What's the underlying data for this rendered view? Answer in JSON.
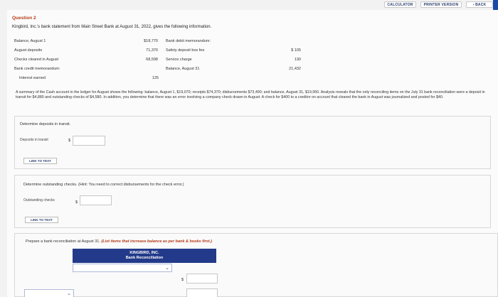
{
  "toolbar": {
    "calculator": "CALCULATOR",
    "printer_version": "PRINTER VERSION",
    "back": "‹ BACK"
  },
  "question": {
    "title": "Question 2",
    "intro": "Kingbird, Inc.'s bank statement from Main Street Bank at August 31, 2022, gives the following information.",
    "facts_left": [
      {
        "label": "Balance, August 1",
        "value": "$18,770"
      },
      {
        "label": "August deposits",
        "value": "71,370"
      },
      {
        "label": "Checks cleared in August",
        "value": "68,598"
      },
      {
        "label": "Bank credit memorandum:",
        "value": ""
      },
      {
        "label": "Interest earned",
        "value": "125"
      }
    ],
    "facts_right": [
      {
        "label": "Bank debit memorandum:",
        "value": ""
      },
      {
        "label": "Safety deposit box fee",
        "value": "$ 105"
      },
      {
        "label": "Service charge",
        "value": "130"
      },
      {
        "label": "Balance, August 31",
        "value": "21,432"
      }
    ],
    "paragraph": "A summary of the Cash account in the ledger for August shows the following: balance, August 1, $19,070; receipts $74,370; disbursements $73,490; and balance, August 31, $19,950. Analysis reveals that the only reconciling items on the July 31 bank reconciliation were a deposit in transit for $4,880 and outstanding checks of $4,580. In addition, you determine that there was an error involving a company check drawn in August: A check for $400 to a creditor on account that cleared the bank in August was journalized and posted for $40."
  },
  "part1": {
    "instruction": "Determine deposits in transit.",
    "field_label": "Deposits in transit",
    "currency": "$",
    "value": "",
    "link": "LINK TO TEXT"
  },
  "part2": {
    "instruction": "Determine outstanding checks. (Hint: You need to correct disbursements for the check error.)",
    "field_label": "Outstanding checks",
    "currency": "$",
    "value": "",
    "link": "LINK TO TEXT"
  },
  "part3": {
    "instruction": "Prepare a bank reconciliation at August 31.",
    "hint": "(List items that increase balance as per bank & books first.)",
    "company": "KINGBIRD, INC.",
    "statement": "Bank Reconciliation",
    "currency": "$",
    "row1_select": "",
    "row1_value": ""
  }
}
